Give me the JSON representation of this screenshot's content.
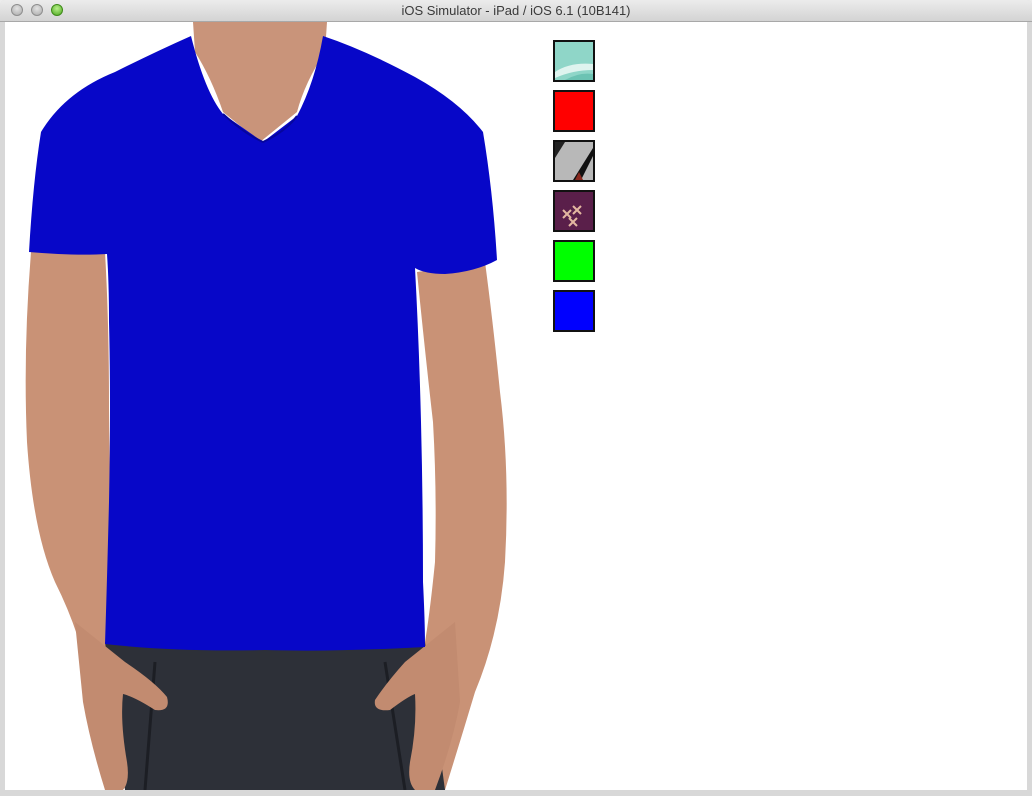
{
  "window": {
    "title": "iOS Simulator - iPad / iOS 6.1 (10B141)"
  },
  "product": {
    "shirt_color": "#0707c8",
    "icon": "shirt-model-image"
  },
  "swatches": [
    {
      "name": "teal-pattern",
      "color": "#8fd6c8"
    },
    {
      "name": "red",
      "color": "#ff0000"
    },
    {
      "name": "gray-black-pattern",
      "color": "#9a9a9a"
    },
    {
      "name": "purple-pattern",
      "color": "#5a1f4a"
    },
    {
      "name": "green",
      "color": "#00ff00"
    },
    {
      "name": "blue",
      "color": "#0000ff"
    }
  ]
}
